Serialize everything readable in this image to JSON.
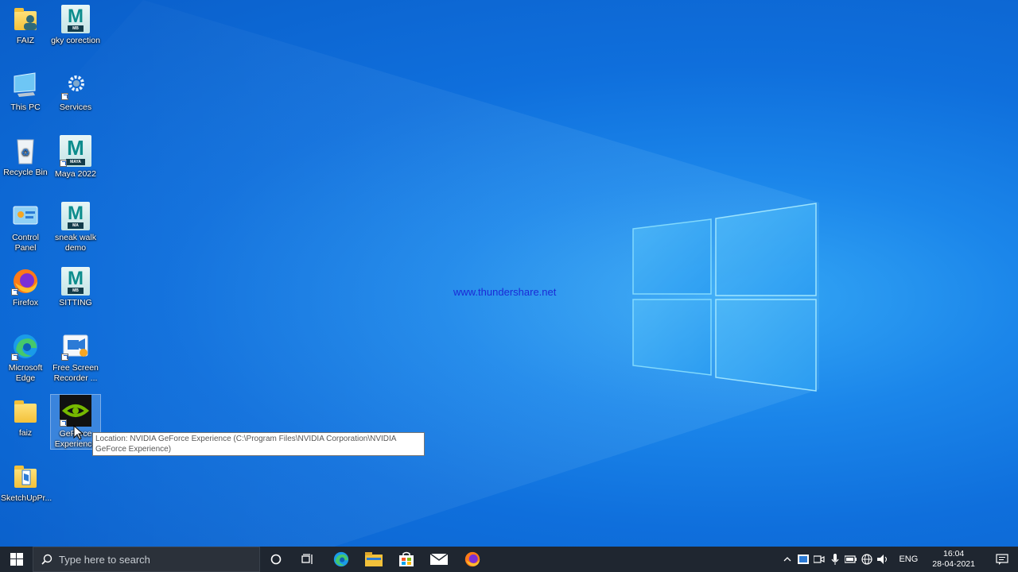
{
  "desktop": {
    "icons": [
      {
        "label": "FAIZ"
      },
      {
        "label": "gky corection"
      },
      {
        "label": "This PC"
      },
      {
        "label": "Services"
      },
      {
        "label": "Recycle Bin"
      },
      {
        "label": "Maya 2022"
      },
      {
        "label": "Control Panel"
      },
      {
        "label": "sneak walk demo"
      },
      {
        "label": "Firefox"
      },
      {
        "label": "SITTING"
      },
      {
        "label": "Microsoft Edge"
      },
      {
        "label": "Free Screen Recorder ..."
      },
      {
        "label": "faiz"
      },
      {
        "label": "GeForce Experience"
      },
      {
        "label": "SketchUpPr..."
      }
    ],
    "maya_tags": {
      "mb": "MB",
      "maya": "MAYA",
      "ma": "MA"
    },
    "watermark": "www.thundershare.net",
    "tooltip": "Location: NVIDIA GeForce Experience (C:\\Program Files\\NVIDIA Corporation\\NVIDIA GeForce Experience)"
  },
  "taskbar": {
    "search_placeholder": "Type here to search",
    "tray": {
      "language": "ENG",
      "time": "16:04",
      "date": "28-04-2021"
    }
  },
  "colors": {
    "accent": "#0f6fdc",
    "taskbar": "#1f2630",
    "watermark": "#1b2bd6"
  }
}
